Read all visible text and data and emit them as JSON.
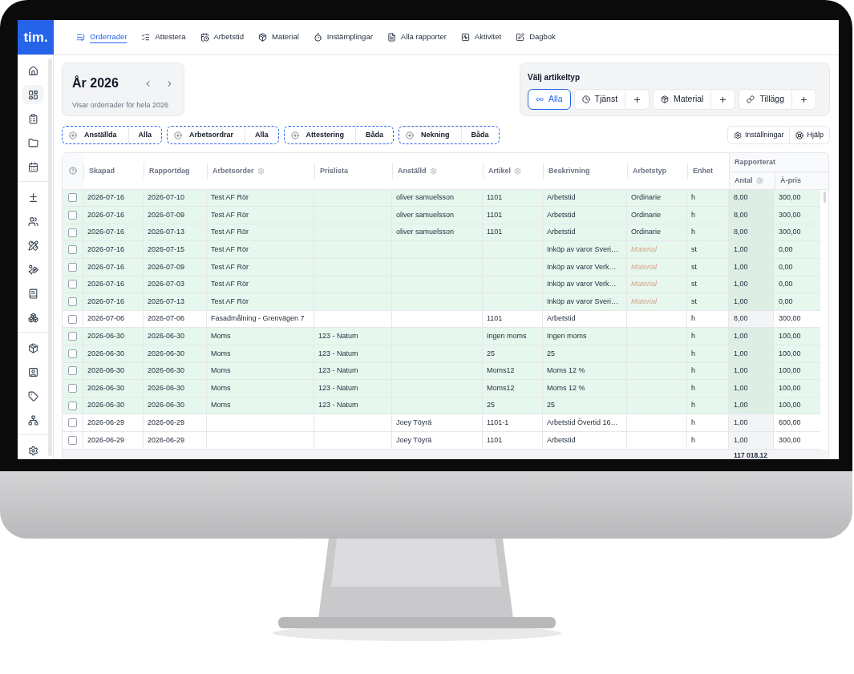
{
  "brand": {
    "logo": "tim."
  },
  "nav": [
    {
      "label": "Orderrader",
      "selected": true
    },
    {
      "label": "Attestera",
      "selected": false
    },
    {
      "label": "Arbetstid",
      "selected": false
    },
    {
      "label": "Material",
      "selected": false
    },
    {
      "label": "Instämplingar",
      "selected": false
    },
    {
      "label": "Alla rapporter",
      "selected": false
    },
    {
      "label": "Aktivitet",
      "selected": false
    },
    {
      "label": "Dagbok",
      "selected": false
    }
  ],
  "sidebar": {
    "groups": [
      {
        "items": [
          {
            "selected": false
          },
          {
            "selected": true
          },
          {
            "selected": false
          },
          {
            "selected": false
          },
          {
            "selected": false
          }
        ]
      },
      {
        "items": [
          {
            "selected": false
          },
          {
            "selected": false
          },
          {
            "selected": false
          },
          {
            "selected": false
          },
          {
            "selected": false
          },
          {
            "selected": false
          }
        ]
      },
      {
        "items": [
          {
            "selected": false
          },
          {
            "selected": false
          },
          {
            "selected": false
          },
          {
            "selected": false
          }
        ]
      },
      {
        "items": [
          {
            "selected": false
          }
        ]
      }
    ]
  },
  "period": {
    "title": "År 2026",
    "subtitle": "Visar orderrader för hela 2026"
  },
  "article_type": {
    "title": "Välj artikeltyp",
    "options": [
      {
        "label": "Alla",
        "selected": true,
        "addable": false
      },
      {
        "label": "Tjänst",
        "selected": false,
        "addable": true
      },
      {
        "label": "Material",
        "selected": false,
        "addable": true
      },
      {
        "label": "Tillägg",
        "selected": false,
        "addable": true
      }
    ]
  },
  "filters": [
    {
      "label": "Anställda",
      "value": "Alla"
    },
    {
      "label": "Arbetsordrar",
      "value": "Alla"
    },
    {
      "label": "Attestering",
      "value": "Båda"
    },
    {
      "label": "Nekning",
      "value": "Båda"
    }
  ],
  "actions": [
    {
      "label": "Inställningar"
    },
    {
      "label": "Hjälp"
    }
  ],
  "table": {
    "columns": [
      {
        "label": "Skapad",
        "has_settings": false
      },
      {
        "label": "Rapportdag",
        "has_settings": false
      },
      {
        "label": "Arbetsorder",
        "has_settings": true
      },
      {
        "label": "Prislista",
        "has_settings": false
      },
      {
        "label": "Anställd",
        "has_settings": true
      },
      {
        "label": "Artikel",
        "has_settings": true
      },
      {
        "label": "Beskrivning",
        "has_settings": false
      },
      {
        "label": "Arbetstyp",
        "has_settings": false
      },
      {
        "label": "Enhet",
        "has_settings": false
      }
    ],
    "column_group": {
      "label": "Rapporterat",
      "columns": [
        {
          "label": "Antal",
          "has_settings": true
        },
        {
          "label": "À-pris",
          "has_settings": false
        }
      ]
    },
    "rows": [
      {
        "highlighted": true,
        "checked": false,
        "skapad": "2026-07-16",
        "rapportdag": "2026-07-10",
        "arbetsorder": "Test AF Rör",
        "anstalld": "oliver samuelsson",
        "artikel": "1101",
        "beskrivning": "Arbetstid",
        "arbetstyp": "Ordinarie",
        "arbetstyp_suggested": false,
        "enhet": "h",
        "antal": "8,00",
        "apris": "300,00"
      },
      {
        "highlighted": true,
        "checked": false,
        "skapad": "2026-07-16",
        "rapportdag": "2026-07-09",
        "arbetsorder": "Test AF Rör",
        "anstalld": "oliver samuelsson",
        "artikel": "1101",
        "beskrivning": "Arbetstid",
        "arbetstyp": "Ordinarie",
        "arbetstyp_suggested": false,
        "enhet": "h",
        "antal": "8,00",
        "apris": "300,00"
      },
      {
        "highlighted": true,
        "checked": false,
        "skapad": "2026-07-16",
        "rapportdag": "2026-07-13",
        "arbetsorder": "Test AF Rör",
        "anstalld": "oliver samuelsson",
        "artikel": "1101",
        "beskrivning": "Arbetstid",
        "arbetstyp": "Ordinarie",
        "arbetstyp_suggested": false,
        "enhet": "h",
        "antal": "8,00",
        "apris": "300,00"
      },
      {
        "highlighted": true,
        "checked": false,
        "skapad": "2026-07-16",
        "rapportdag": "2026-07-15",
        "arbetsorder": "Test AF Rör",
        "beskrivning": "Inköp av varor Sveri…",
        "arbetstyp": "Material",
        "arbetstyp_suggested": true,
        "enhet": "st",
        "antal": "1,00",
        "apris": "0,00"
      },
      {
        "highlighted": true,
        "checked": false,
        "skapad": "2026-07-16",
        "rapportdag": "2026-07-09",
        "arbetsorder": "Test AF Rör",
        "beskrivning": "Inköp av varor Verk…",
        "arbetstyp": "Material",
        "arbetstyp_suggested": true,
        "enhet": "st",
        "antal": "1,00",
        "apris": "0,00"
      },
      {
        "highlighted": true,
        "checked": false,
        "skapad": "2026-07-16",
        "rapportdag": "2026-07-03",
        "arbetsorder": "Test AF Rör",
        "beskrivning": "Inköp av varor Verk…",
        "arbetstyp": "Material",
        "arbetstyp_suggested": true,
        "enhet": "st",
        "antal": "1,00",
        "apris": "0,00"
      },
      {
        "highlighted": true,
        "checked": false,
        "skapad": "2026-07-16",
        "rapportdag": "2026-07-13",
        "arbetsorder": "Test AF Rör",
        "beskrivning": "Inköp av varor Sveri…",
        "arbetstyp": "Material",
        "arbetstyp_suggested": true,
        "enhet": "st",
        "antal": "1,00",
        "apris": "0,00"
      },
      {
        "highlighted": false,
        "checked": false,
        "skapad": "2026-07-06",
        "rapportdag": "2026-07-06",
        "arbetsorder": "Fasadmålning - Grenvägen 7",
        "artikel": "1101",
        "beskrivning": "Arbetstid",
        "enhet": "h",
        "antal": "8,00",
        "apris": "300,00"
      },
      {
        "highlighted": true,
        "checked": false,
        "skapad": "2026-06-30",
        "rapportdag": "2026-06-30",
        "arbetsorder": "Moms",
        "prislista": "123 - Natum",
        "artikel": "Ingen moms",
        "beskrivning": "Ingen moms",
        "enhet": "h",
        "antal": "1,00",
        "apris": "100,00"
      },
      {
        "highlighted": true,
        "checked": false,
        "skapad": "2026-06-30",
        "rapportdag": "2026-06-30",
        "arbetsorder": "Moms",
        "prislista": "123 - Natum",
        "artikel": "25",
        "beskrivning": "25",
        "enhet": "h",
        "antal": "1,00",
        "apris": "100,00"
      },
      {
        "highlighted": true,
        "checked": false,
        "skapad": "2026-06-30",
        "rapportdag": "2026-06-30",
        "arbetsorder": "Moms",
        "prislista": "123 - Natum",
        "artikel": "Moms12",
        "beskrivning": "Moms 12 %",
        "enhet": "h",
        "antal": "1,00",
        "apris": "100,00"
      },
      {
        "highlighted": true,
        "checked": false,
        "skapad": "2026-06-30",
        "rapportdag": "2026-06-30",
        "arbetsorder": "Moms",
        "prislista": "123 - Natum",
        "artikel": "Moms12",
        "beskrivning": "Moms 12 %",
        "enhet": "h",
        "antal": "1,00",
        "apris": "100,00"
      },
      {
        "highlighted": true,
        "checked": false,
        "skapad": "2026-06-30",
        "rapportdag": "2026-06-30",
        "arbetsorder": "Moms",
        "prislista": "123 - Natum",
        "artikel": "25",
        "beskrivning": "25",
        "enhet": "h",
        "antal": "1,00",
        "apris": "100,00"
      },
      {
        "highlighted": false,
        "checked": false,
        "skapad": "2026-06-29",
        "rapportdag": "2026-06-29",
        "anstalld": "Joey Töyrä",
        "artikel": "1101-1",
        "beskrivning": "Arbetstid Övertid 16…",
        "enhet": "h",
        "antal": "1,00",
        "apris": "600,00"
      },
      {
        "highlighted": false,
        "checked": false,
        "skapad": "2026-06-29",
        "rapportdag": "2026-06-29",
        "anstalld": "Joey Töyrä",
        "artikel": "1101",
        "beskrivning": "Arbetstid",
        "enhet": "h",
        "antal": "1,00",
        "apris": "300,00"
      }
    ],
    "footer": {
      "antal_total": "117 018,12"
    }
  }
}
